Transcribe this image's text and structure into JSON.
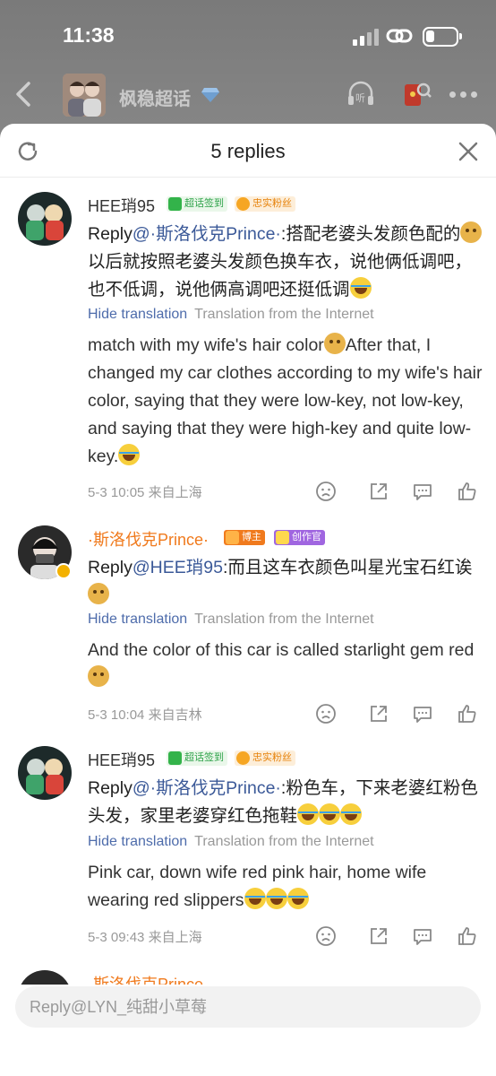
{
  "status_bar": {
    "time": "11:38"
  },
  "nav": {
    "topic_name": "枫稳超话"
  },
  "sheet": {
    "title": "5 replies",
    "close_icon": "close-icon",
    "refresh_icon": "refresh-icon"
  },
  "labels": {
    "hide_translation": "Hide translation",
    "translation_source": "Translation from the Internet"
  },
  "badges": {
    "sign": "超话签到",
    "fan": "忠实粉丝",
    "boss": "博主",
    "creator": "创作官"
  },
  "comments": [
    {
      "user": "HEE琑95",
      "reply_prefix": "Reply",
      "mention": "@·斯洛伐克Prince·",
      "text_a": ":搭配老婆头发颜色配的",
      "text_b": "以后就按照老婆头发颜色换车衣，说他俩低调吧，也不低调，说他俩高调吧还挺低调",
      "translation_a": "match with my wife's hair color",
      "translation_b": "After that, I changed my car clothes according to my wife's hair color, saying that they were low-key, not low-key, and saying that they were high-key and quite low-key.",
      "date": "5-3 10:05",
      "location": "来自上海"
    },
    {
      "user": "·斯洛伐克Prince·",
      "reply_prefix": "Reply",
      "mention": "@HEE琑95",
      "text_a": ":而且这车衣颜色叫星光宝石红诶",
      "translation_a": "And the color of this car is called starlight gem red",
      "date": "5-3 10:04",
      "location": "来自吉林"
    },
    {
      "user": "HEE琑95",
      "reply_prefix": "Reply",
      "mention": "@·斯洛伐克Prince·",
      "text_a": ":粉色车，下来老婆红粉色头发，家里老婆穿红色拖鞋",
      "translation_a": "Pink car, down wife red pink hair, home wife wearing red slippers",
      "date": "5-3 09:43",
      "location": "来自上海"
    }
  ],
  "next_user": "·斯洛伐克Prince·",
  "input": {
    "placeholder": "Reply@LYN_纯甜小草莓"
  }
}
